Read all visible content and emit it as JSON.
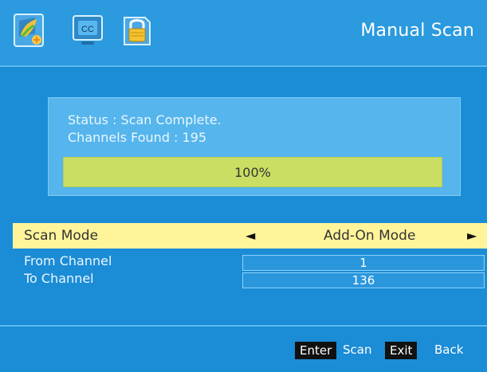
{
  "header": {
    "title": "Manual Scan",
    "icons": [
      "picture-icon",
      "closed-caption-icon",
      "lock-icon"
    ],
    "cc_icon_text": "CC"
  },
  "status": {
    "line1": "Status : Scan Complete.",
    "line2": "Channels Found : 195",
    "progress_label": "100%",
    "progress_value": 1.0
  },
  "scan_mode": {
    "label": "Scan Mode",
    "value": "Add-On Mode",
    "left_arrow": "◄",
    "right_arrow": "►"
  },
  "channels": {
    "from_label": "From Channel",
    "from_value": "1",
    "to_label": "To Channel",
    "to_value": "136"
  },
  "footer": {
    "enter_key": "Enter",
    "enter_label": "Scan",
    "exit_key": "Exit",
    "exit_label": "Back"
  },
  "colors": {
    "background": "#1b8cd6",
    "header": "#2b9ade",
    "status_panel": "#55b5ec",
    "progress": "#c9de63",
    "highlight_row": "#fff49a"
  }
}
